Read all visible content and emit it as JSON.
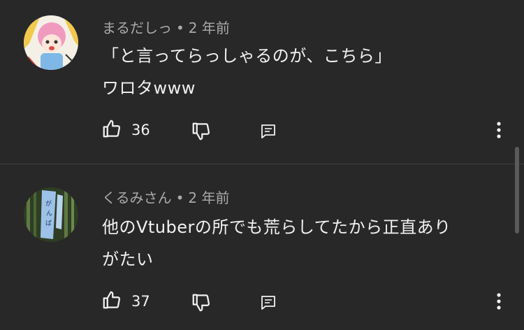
{
  "comments": [
    {
      "author": "まるだしっ",
      "separator": "•",
      "time": "2 年前",
      "lines": [
        "「と言ってらっしゃるのが、こちら」",
        "ワロタwww"
      ],
      "likes": "36",
      "avatar_icon": "anime-girl-avatar",
      "accent": "#f19ac0"
    },
    {
      "author": "くるみさん",
      "separator": "•",
      "time": "2 年前",
      "lines": [
        "他のVtuberの所でも荒らしてたから正直あり",
        "がたい"
      ],
      "likes": "37",
      "avatar_icon": "bamboo-banner-avatar",
      "accent": "#4f6b3a"
    }
  ],
  "icons": {
    "like": "thumb-up-icon",
    "dislike": "thumb-down-icon",
    "reply": "reply-comment-icon",
    "more": "more-vertical-icon"
  }
}
